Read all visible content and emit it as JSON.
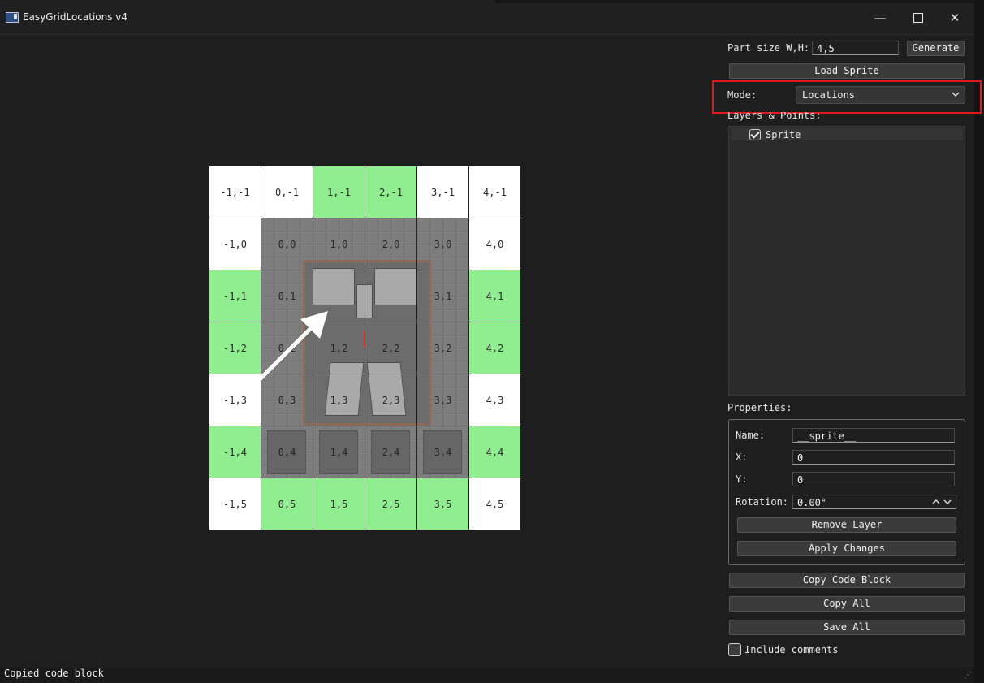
{
  "window": {
    "title": "EasyGridLocations v4",
    "minimize_glyph": "—",
    "close_glyph": "✕"
  },
  "grid": {
    "rows": [
      [
        {
          "label": "-1,-1",
          "color": "white"
        },
        {
          "label": "0,-1",
          "color": "white"
        },
        {
          "label": "1,-1",
          "color": "green"
        },
        {
          "label": "2,-1",
          "color": "green"
        },
        {
          "label": "3,-1",
          "color": "white"
        },
        {
          "label": "4,-1",
          "color": "white"
        }
      ],
      [
        {
          "label": "-1,0",
          "color": "white"
        },
        {
          "label": "0,0",
          "color": "sprite"
        },
        {
          "label": "1,0",
          "color": "sprite"
        },
        {
          "label": "2,0",
          "color": "sprite"
        },
        {
          "label": "3,0",
          "color": "sprite"
        },
        {
          "label": "4,0",
          "color": "white"
        }
      ],
      [
        {
          "label": "-1,1",
          "color": "green"
        },
        {
          "label": "0,1",
          "color": "sprite"
        },
        {
          "label": "",
          "color": "sprite"
        },
        {
          "label": "",
          "color": "sprite"
        },
        {
          "label": "3,1",
          "color": "sprite"
        },
        {
          "label": "4,1",
          "color": "green"
        }
      ],
      [
        {
          "label": "-1,2",
          "color": "green"
        },
        {
          "label": "0,2",
          "color": "sprite"
        },
        {
          "label": "1,2",
          "color": "sprite"
        },
        {
          "label": "2,2",
          "color": "sprite"
        },
        {
          "label": "3,2",
          "color": "sprite"
        },
        {
          "label": "4,2",
          "color": "green"
        }
      ],
      [
        {
          "label": "-1,3",
          "color": "white"
        },
        {
          "label": "0,3",
          "color": "sprite"
        },
        {
          "label": "1,3",
          "color": "sprite"
        },
        {
          "label": "2,3",
          "color": "sprite"
        },
        {
          "label": "3,3",
          "color": "sprite"
        },
        {
          "label": "4,3",
          "color": "white"
        }
      ],
      [
        {
          "label": "-1,4",
          "color": "green"
        },
        {
          "label": "0,4",
          "color": "sprite"
        },
        {
          "label": "1,4",
          "color": "sprite"
        },
        {
          "label": "2,4",
          "color": "sprite"
        },
        {
          "label": "3,4",
          "color": "sprite"
        },
        {
          "label": "4,4",
          "color": "green"
        }
      ],
      [
        {
          "label": "-1,5",
          "color": "white"
        },
        {
          "label": "0,5",
          "color": "green"
        },
        {
          "label": "1,5",
          "color": "green"
        },
        {
          "label": "2,5",
          "color": "green"
        },
        {
          "label": "3,5",
          "color": "green"
        },
        {
          "label": "4,5",
          "color": "white"
        }
      ]
    ],
    "colors": {
      "white": "#ffffff",
      "green": "#90ee90"
    }
  },
  "panel": {
    "part_size_label": "Part size W,H:",
    "part_size_value": "4,5",
    "generate_label": "Generate",
    "load_sprite_label": "Load Sprite",
    "mode_label": "Mode:",
    "mode_value": "Locations",
    "layers_label": "Layers & Points:",
    "layers": [
      {
        "name": "Sprite",
        "checked": true
      }
    ],
    "properties_label": "Properties:",
    "properties": {
      "name_label": "Name:",
      "name_value": "__sprite__",
      "x_label": "X:",
      "x_value": "0",
      "y_label": "Y:",
      "y_value": "0",
      "rotation_label": "Rotation:",
      "rotation_value": "0.00°"
    },
    "remove_layer_label": "Remove Layer",
    "apply_changes_label": "Apply Changes",
    "copy_code_block_label": "Copy Code Block",
    "copy_all_label": "Copy All",
    "save_all_label": "Save All",
    "include_comments_label": "Include comments",
    "include_comments_checked": false
  },
  "status": {
    "text": "Copied code block"
  },
  "accent": {
    "highlight": "#e0191b"
  }
}
